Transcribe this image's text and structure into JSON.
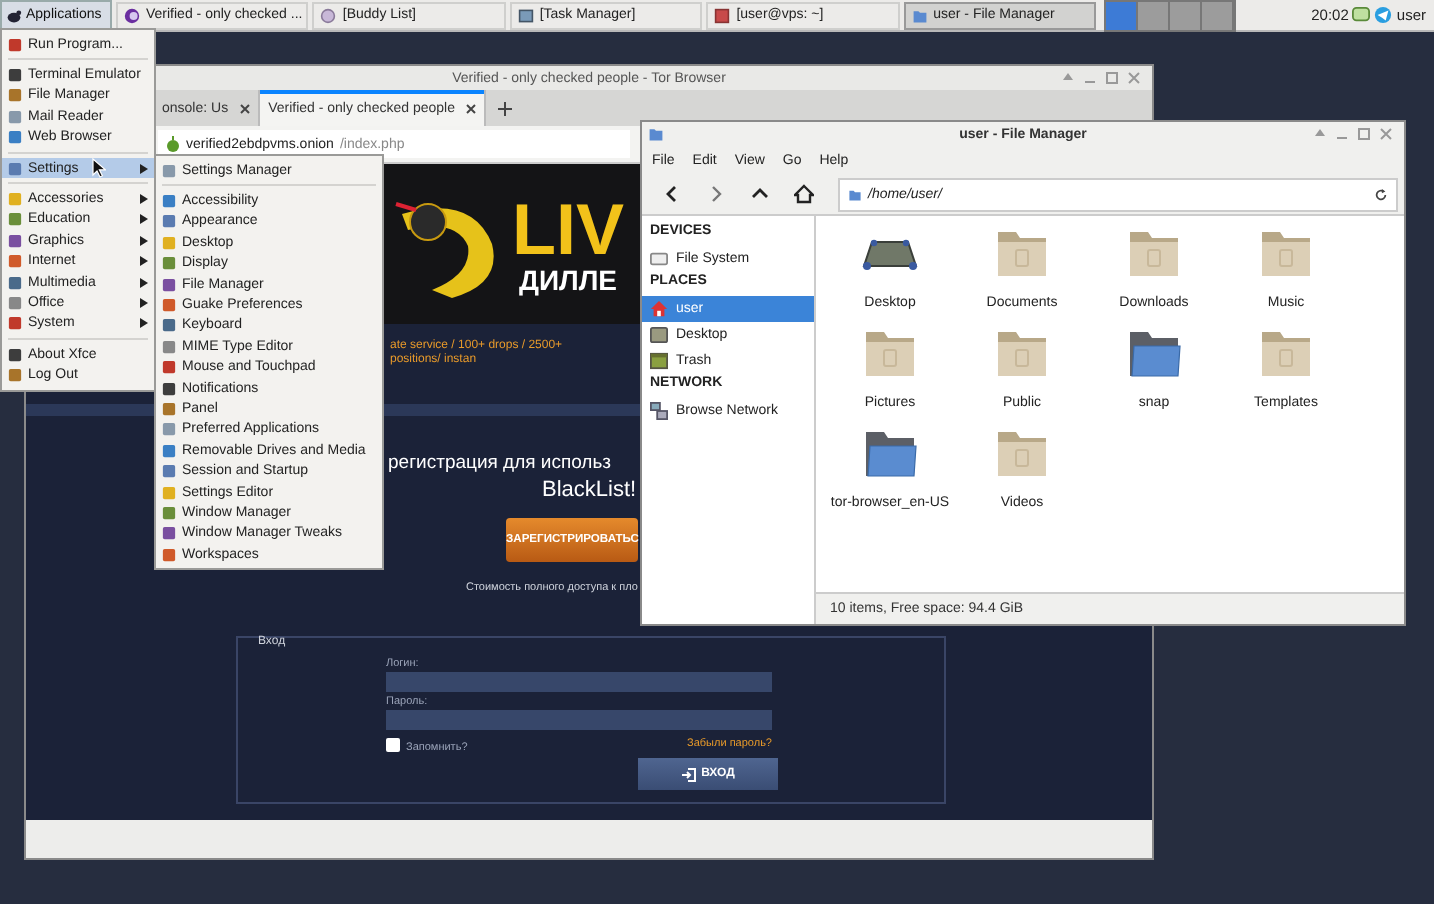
{
  "panel": {
    "menu_button": "Applications",
    "tasks": [
      {
        "label": "Verified - only checked ...",
        "kind": "browser",
        "selected": false
      },
      {
        "label": "[Buddy List]",
        "kind": "chat",
        "selected": false
      },
      {
        "label": "[Task Manager]",
        "kind": "monitor",
        "selected": false
      },
      {
        "label": "[user@vps: ~]",
        "kind": "terminal",
        "selected": false
      },
      {
        "label": "user - File Manager",
        "kind": "folder",
        "selected": true
      }
    ],
    "workspaces": [
      {
        "selected": true
      },
      {
        "selected": false
      },
      {
        "selected": false
      },
      {
        "selected": false
      }
    ],
    "clock": "20:02",
    "user": "user"
  },
  "browser": {
    "title": "Verified - only checked people - Tor Browser",
    "tabs": [
      {
        "label": "onsole: Us",
        "selected": false
      },
      {
        "label": "Verified - only checked people",
        "selected": true
      }
    ],
    "address": {
      "host": "verified2ebdpvms.onion",
      "path": "/index.php"
    },
    "page": {
      "banner": {
        "headline": "LIV",
        "subline": "ДИЛЛЕ"
      },
      "tagline": "ate service / 100+ drops / 2500+ positions/ instan",
      "signup_heading": "регистрация для использ",
      "signup_heading_2": "BlackList!",
      "signup_button": "ЗАРЕГИСТРИРОВАТЬС",
      "price_note": "Стоимость полного доступа к пло",
      "login": {
        "legend": "Вход",
        "username_label": "Логин:",
        "password_label": "Пароль:",
        "remember": {
          "label": "Запомнить?",
          "checked": false
        },
        "forgot_link": "Забыли пароль?",
        "submit": "ВХОД"
      }
    }
  },
  "file_manager": {
    "title": "user - File Manager",
    "menu": [
      "File",
      "Edit",
      "View",
      "Go",
      "Help"
    ],
    "path": "/home/user/",
    "sidebar": [
      {
        "heading": "DEVICES",
        "items": [
          {
            "label": "File System",
            "kind": "drive",
            "selected": false
          }
        ]
      },
      {
        "heading": "PLACES",
        "items": [
          {
            "label": "user",
            "kind": "home",
            "selected": true
          },
          {
            "label": "Desktop",
            "kind": "desktop",
            "selected": false
          },
          {
            "label": "Trash",
            "kind": "trash",
            "selected": false
          }
        ]
      },
      {
        "heading": "NETWORK",
        "items": [
          {
            "label": "Browse Network",
            "kind": "network",
            "selected": false
          }
        ]
      }
    ],
    "files": [
      {
        "name": "Desktop",
        "kind": "desktop"
      },
      {
        "name": "Documents",
        "kind": "folder"
      },
      {
        "name": "Downloads",
        "kind": "folder"
      },
      {
        "name": "Music",
        "kind": "folder"
      },
      {
        "name": "Pictures",
        "kind": "folder"
      },
      {
        "name": "Public",
        "kind": "folder"
      },
      {
        "name": "snap",
        "kind": "blue_folder"
      },
      {
        "name": "Templates",
        "kind": "folder"
      },
      {
        "name": "tor-browser_en-US",
        "kind": "blue_folder"
      },
      {
        "name": "Videos",
        "kind": "folder"
      }
    ],
    "status": "10 items, Free space: 94.4 GiB"
  },
  "app_menu": {
    "groups": [
      [
        {
          "label": "Run Program...",
          "submenu": false,
          "selected": false
        }
      ],
      [
        {
          "label": "Terminal Emulator",
          "submenu": false,
          "selected": false
        },
        {
          "label": "File Manager",
          "submenu": false,
          "selected": false
        },
        {
          "label": "Mail Reader",
          "submenu": false,
          "selected": false
        },
        {
          "label": "Web Browser",
          "submenu": false,
          "selected": false
        }
      ],
      [
        {
          "label": "Settings",
          "submenu": true,
          "selected": true
        }
      ],
      [
        {
          "label": "Accessories",
          "submenu": true,
          "selected": false
        },
        {
          "label": "Education",
          "submenu": true,
          "selected": false
        },
        {
          "label": "Graphics",
          "submenu": true,
          "selected": false
        },
        {
          "label": "Internet",
          "submenu": true,
          "selected": false
        },
        {
          "label": "Multimedia",
          "submenu": true,
          "selected": false
        },
        {
          "label": "Office",
          "submenu": true,
          "selected": false
        },
        {
          "label": "System",
          "submenu": true,
          "selected": false
        }
      ],
      [
        {
          "label": "About Xfce",
          "submenu": false,
          "selected": false
        },
        {
          "label": "Log Out",
          "submenu": false,
          "selected": false
        }
      ]
    ]
  },
  "settings_menu": {
    "groups": [
      [
        {
          "label": "Settings Manager",
          "selected": false
        }
      ],
      [
        {
          "label": "Accessibility",
          "selected": false
        },
        {
          "label": "Appearance",
          "selected": false
        },
        {
          "label": "Desktop",
          "selected": false
        },
        {
          "label": "Display",
          "selected": false
        },
        {
          "label": "File Manager",
          "selected": false
        },
        {
          "label": "Guake Preferences",
          "selected": false
        },
        {
          "label": "Keyboard",
          "selected": false
        },
        {
          "label": "MIME Type Editor",
          "selected": false
        },
        {
          "label": "Mouse and Touchpad",
          "selected": false
        },
        {
          "label": "Notifications",
          "selected": false
        },
        {
          "label": "Panel",
          "selected": false
        },
        {
          "label": "Preferred Applications",
          "selected": false
        },
        {
          "label": "Removable Drives and Media",
          "selected": false
        },
        {
          "label": "Session and Startup",
          "selected": false
        },
        {
          "label": "Settings Editor",
          "selected": false
        },
        {
          "label": "Window Manager",
          "selected": false
        },
        {
          "label": "Window Manager Tweaks",
          "selected": false
        },
        {
          "label": "Workspaces",
          "selected": false
        }
      ]
    ]
  }
}
